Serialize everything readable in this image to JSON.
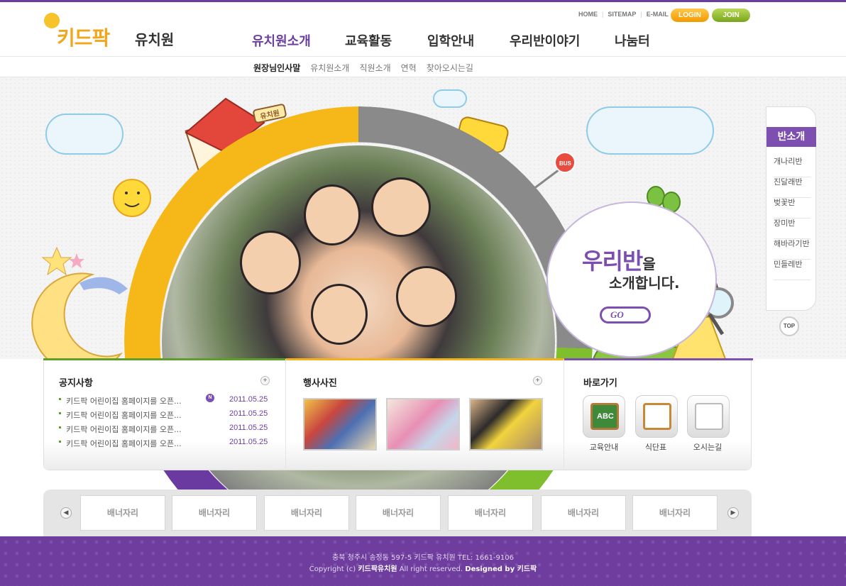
{
  "header": {
    "logo_kid": "키드팍",
    "logo_school": "유치원",
    "util_links": [
      "HOME",
      "SITEMAP",
      "E-MAIL"
    ],
    "login_label": "LOGIN",
    "join_label": "JOIN",
    "gnb": [
      "유치원소개",
      "교육활동",
      "입학안내",
      "우리반이야기",
      "나눔터"
    ],
    "snb": [
      "원장님인사말",
      "유치원소개",
      "직원소개",
      "연혁",
      "찾아오시는길"
    ]
  },
  "visual": {
    "slogan_main": "우리반",
    "slogan_particle": "을",
    "slogan_sub": "소개합니다.",
    "go_label": "GO",
    "sign_label": "유치원",
    "bus_sign": "BUS"
  },
  "quick_menu": {
    "title": "반소개",
    "items": [
      "개나리반",
      "진달래반",
      "벚꽃반",
      "장미반",
      "해바라기반",
      "민들레반"
    ],
    "top_label": "TOP"
  },
  "notice": {
    "title": "공지사항",
    "new_badge": "N",
    "rows": [
      {
        "text": "키드팍 어린이집 홈페이지를 오픈...",
        "date": "2011.05.25"
      },
      {
        "text": "키드팍 어린이집 홈페이지를 오픈...",
        "date": "2011.05.25"
      },
      {
        "text": "키드팍 어린이집 홈페이지를 오픈...",
        "date": "2011.05.25"
      },
      {
        "text": "키드팍 어린이집 홈페이지를 오픈...",
        "date": "2011.05.25"
      }
    ]
  },
  "photos": {
    "title": "행사사진"
  },
  "shortcuts": {
    "title": "바로가기",
    "items": [
      "교육안내",
      "식단표",
      "오시는길"
    ],
    "abc_label": "ABC"
  },
  "banners": [
    "배너자리",
    "배너자리",
    "배너자리",
    "배너자리",
    "배너자리",
    "배너자리",
    "배너자리"
  ],
  "footer": {
    "address": "충북 청주시 송정동 597-5 키드팍 유치원  TEL: 1661-9106",
    "copyright_prefix": "Copyright (c) ",
    "copyright_name": "키드팍유치원",
    "copyright_mid": " All right reserved. ",
    "designed_by": "Designed by 키드팍"
  },
  "colors": {
    "primary_purple": "#6b3fa0",
    "green": "#5f9d2c",
    "yellow": "#f3b21b"
  }
}
